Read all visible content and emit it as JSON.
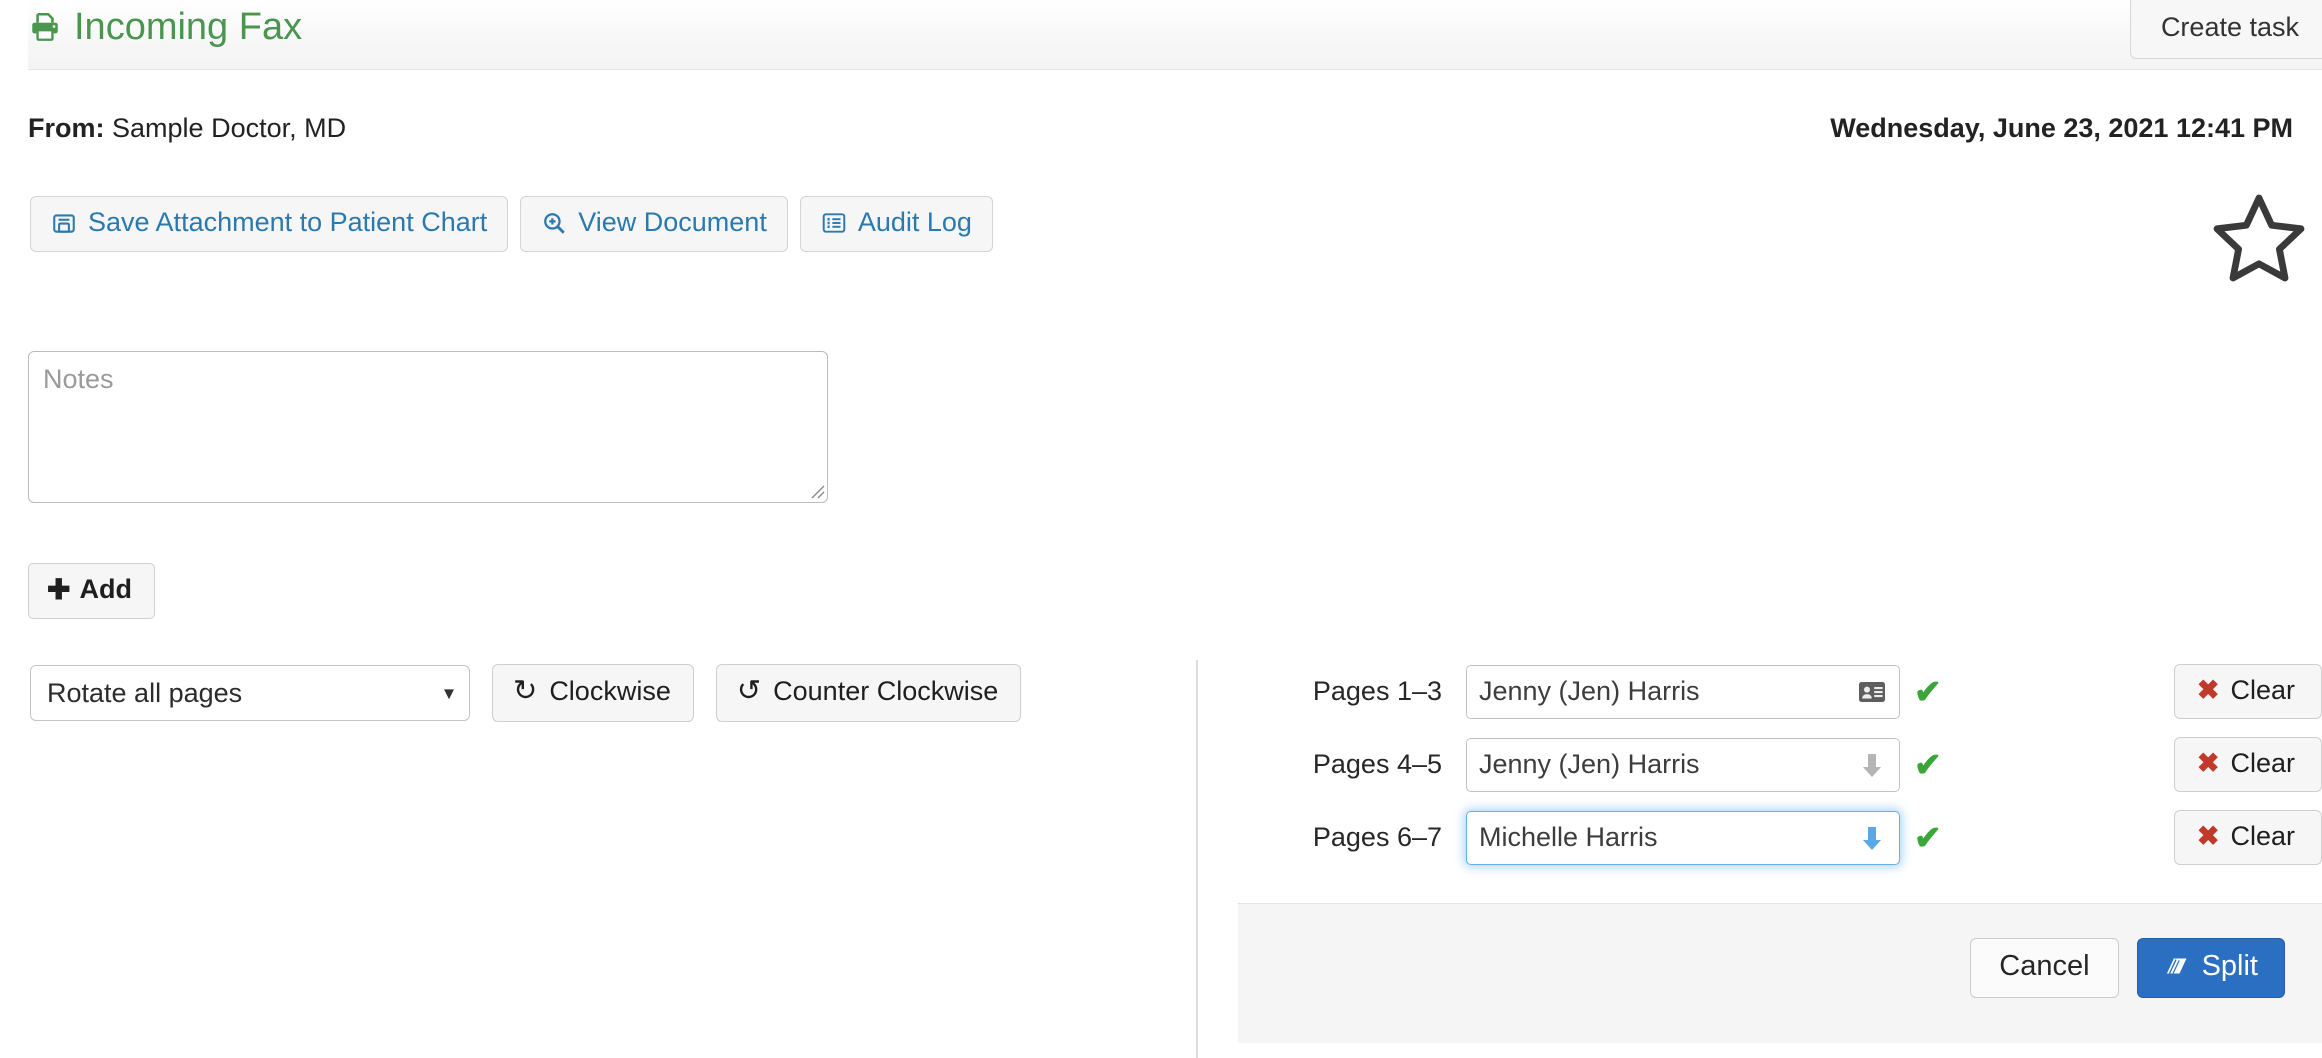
{
  "header": {
    "title": "Incoming Fax",
    "title_icon": "printer-icon",
    "title_color": "#4a964f",
    "create_task_label": "Create task"
  },
  "meta": {
    "from_label": "From:",
    "from_value": "Sample Doctor, MD",
    "date": "Wednesday, June 23, 2021 12:41 PM"
  },
  "actions": {
    "buttons": [
      {
        "label": "Save Attachment to Patient Chart",
        "icon": "save-floppy-icon"
      },
      {
        "label": "View Document",
        "icon": "magnifier-plus-icon"
      },
      {
        "label": "Audit Log",
        "icon": "list-log-icon"
      }
    ],
    "link_color": "#2a7ab0",
    "favorite_icon": "star-outline-icon"
  },
  "notes": {
    "placeholder": "Notes",
    "value": "",
    "add_label": "Add",
    "add_icon": "plus-icon"
  },
  "rotate": {
    "select_value": "Rotate all pages",
    "options": [
      "Rotate all pages"
    ],
    "clockwise_label": "Clockwise",
    "clockwise_icon": "rotate-clockwise-icon",
    "counter_clockwise_label": "Counter Clockwise",
    "counter_clockwise_icon": "rotate-counter-clockwise-icon"
  },
  "split": {
    "rows": [
      {
        "pages_label": "Pages 1–3",
        "recipient": "Jenny (Jen) Harris",
        "field_icon": "address-card-icon",
        "valid_icon": "✔",
        "clear_label": "Clear",
        "clear_icon": "✖",
        "focused": false
      },
      {
        "pages_label": "Pages 4–5",
        "recipient": "Jenny (Jen) Harris",
        "field_icon": "arrow-down-gray-icon",
        "valid_icon": "✔",
        "clear_label": "Clear",
        "clear_icon": "✖",
        "focused": false
      },
      {
        "pages_label": "Pages 6–7",
        "recipient": "Michelle Harris",
        "field_icon": "arrow-down-blue-icon",
        "valid_icon": "✔",
        "clear_label": "Clear",
        "clear_icon": "✖",
        "focused": true
      }
    ],
    "valid_color": "#3aa63a",
    "clear_x_color": "#c0392b",
    "cancel_label": "Cancel",
    "split_label": "Split",
    "split_icon": "book-split-icon",
    "split_button_color": "#2a6fc2"
  }
}
